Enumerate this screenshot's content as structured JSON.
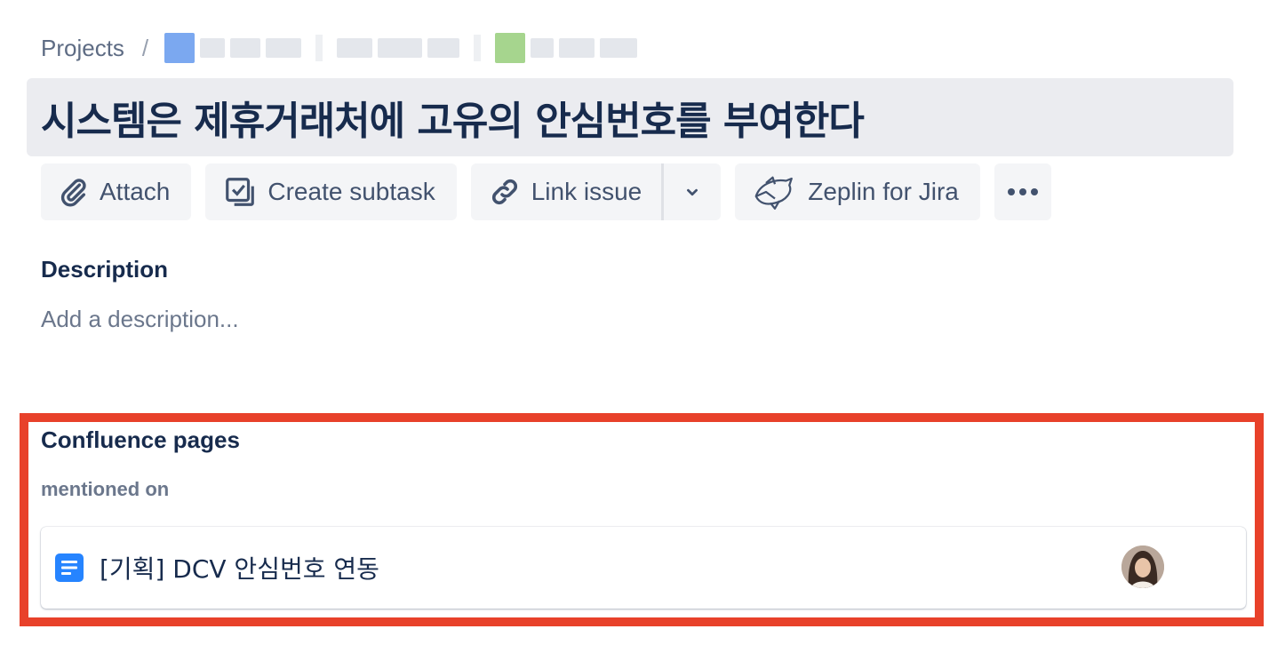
{
  "breadcrumb": {
    "root": "Projects",
    "separator": "/"
  },
  "issue": {
    "title": "시스템은 제휴거래처에 고유의 안심번호를 부여한다"
  },
  "toolbar": {
    "attach_label": "Attach",
    "attach_icon": "paperclip-icon",
    "create_subtask_label": "Create subtask",
    "create_subtask_icon": "subtask-icon",
    "link_issue_label": "Link issue",
    "link_issue_icon": "link-icon",
    "link_dropdown_icon": "chevron-down-icon",
    "zeplin_label": "Zeplin for Jira",
    "zeplin_icon": "zeplin-icon",
    "more_icon": "more-horizontal-icon"
  },
  "description": {
    "heading": "Description",
    "placeholder": "Add a description..."
  },
  "confluence": {
    "heading": "Confluence pages",
    "subheading": "mentioned on",
    "pages": [
      {
        "title": "[기획] DCV 안심번호 연동",
        "icon": "document-icon",
        "author_avatar": "avatar"
      }
    ]
  },
  "colors": {
    "highlight_border": "#e8412a",
    "accent_blue": "#2684ff",
    "text_primary": "#172b4d",
    "text_subtle": "#6b778c"
  }
}
